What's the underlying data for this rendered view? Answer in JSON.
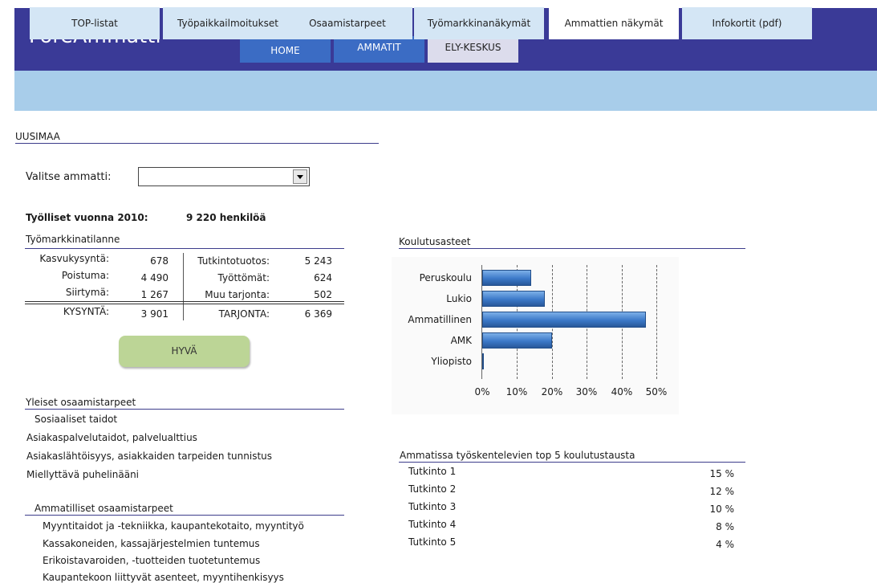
{
  "app": {
    "title": "ForeAmmatti"
  },
  "top_tabs": [
    "HOME",
    "AMMATIT",
    "ELY-KESKUS"
  ],
  "sub_tabs": [
    "TOP-listat",
    "Työpaikkailmoitukset",
    "Osaamistarpeet",
    "Työmarkkinanäkymät",
    "Ammattien näkymät",
    "Infokortit (pdf)"
  ],
  "active_sub_tab": "Ammattien näkymät",
  "region": "UUSIMAA",
  "select": {
    "label": "Valitse ammatti:",
    "value": ""
  },
  "employed": {
    "label": "Työlliset vuonna 2010:",
    "value": "9 220 henkilöä"
  },
  "labour_market": {
    "title": "Työmarkkinatilanne",
    "demand": [
      {
        "label": "Kasvukysyntä:",
        "value": "678"
      },
      {
        "label": "Poistuma:",
        "value": "4 490"
      },
      {
        "label": "Siirtymä:",
        "value": "1 267"
      }
    ],
    "supply": [
      {
        "label": "Tutkintotuotos:",
        "value": "5 243"
      },
      {
        "label": "Työttömät:",
        "value": "624"
      },
      {
        "label": "Muu tarjonta:",
        "value": "502"
      }
    ],
    "demand_total": {
      "label": "KYSYNTÄ:",
      "value": "3 901"
    },
    "supply_total": {
      "label": "TARJONTA:",
      "value": "6 369"
    }
  },
  "status_button": "HYVÄ",
  "general_skills": {
    "title": "Yleiset osaamistarpeet",
    "items": [
      "Sosiaaliset taidot",
      "Asiakaspalvelutaidot, palvelualttius",
      "Asiakaslähtöisyys, asiakkaiden tarpeiden tunnistus",
      "Miellyttävä puhelinääni"
    ]
  },
  "professional_skills": {
    "title": "Ammatilliset osaamistarpeet",
    "items": [
      "Myyntitaidot ja -tekniikka, kaupantekotaito, myyntityö",
      "Kassakoneiden, kassajärjestelmien tuntemus",
      "Erikoistavaroiden, -tuotteiden tuotetuntemus",
      "Kaupantekoon liittyvät asenteet, myyntihenkisyys"
    ]
  },
  "education_chart": {
    "title": "Koulutusasteet"
  },
  "chart_data": {
    "type": "bar",
    "orientation": "horizontal",
    "categories": [
      "Peruskoulu",
      "Lukio",
      "Ammatillinen",
      "AMK",
      "Yliopisto"
    ],
    "values": [
      14,
      18,
      47,
      20,
      0
    ],
    "value_unit": "%",
    "xlim": [
      0,
      50
    ],
    "ticks": [
      "0%",
      "10%",
      "20%",
      "30%",
      "40%",
      "50%"
    ],
    "grid": true
  },
  "top5": {
    "title": "Ammatissa työskentelevien top 5 koulutustausta",
    "rows": [
      {
        "name": "Tutkinto 1",
        "value": "15 %"
      },
      {
        "name": "Tutkinto 2",
        "value": "12 %"
      },
      {
        "name": "Tutkinto 3",
        "value": "10 %"
      },
      {
        "name": "Tutkinto 4",
        "value": "8 %"
      },
      {
        "name": "Tutkinto 5",
        "value": "4 %"
      }
    ]
  },
  "colors": {
    "header": "#3a3a97",
    "top_tab": "#3b6cc4",
    "subnav": "#a8cdea",
    "sub_tab": "#d4e6f5",
    "status_button": "#bcd596",
    "bar": "#3b78c8"
  }
}
